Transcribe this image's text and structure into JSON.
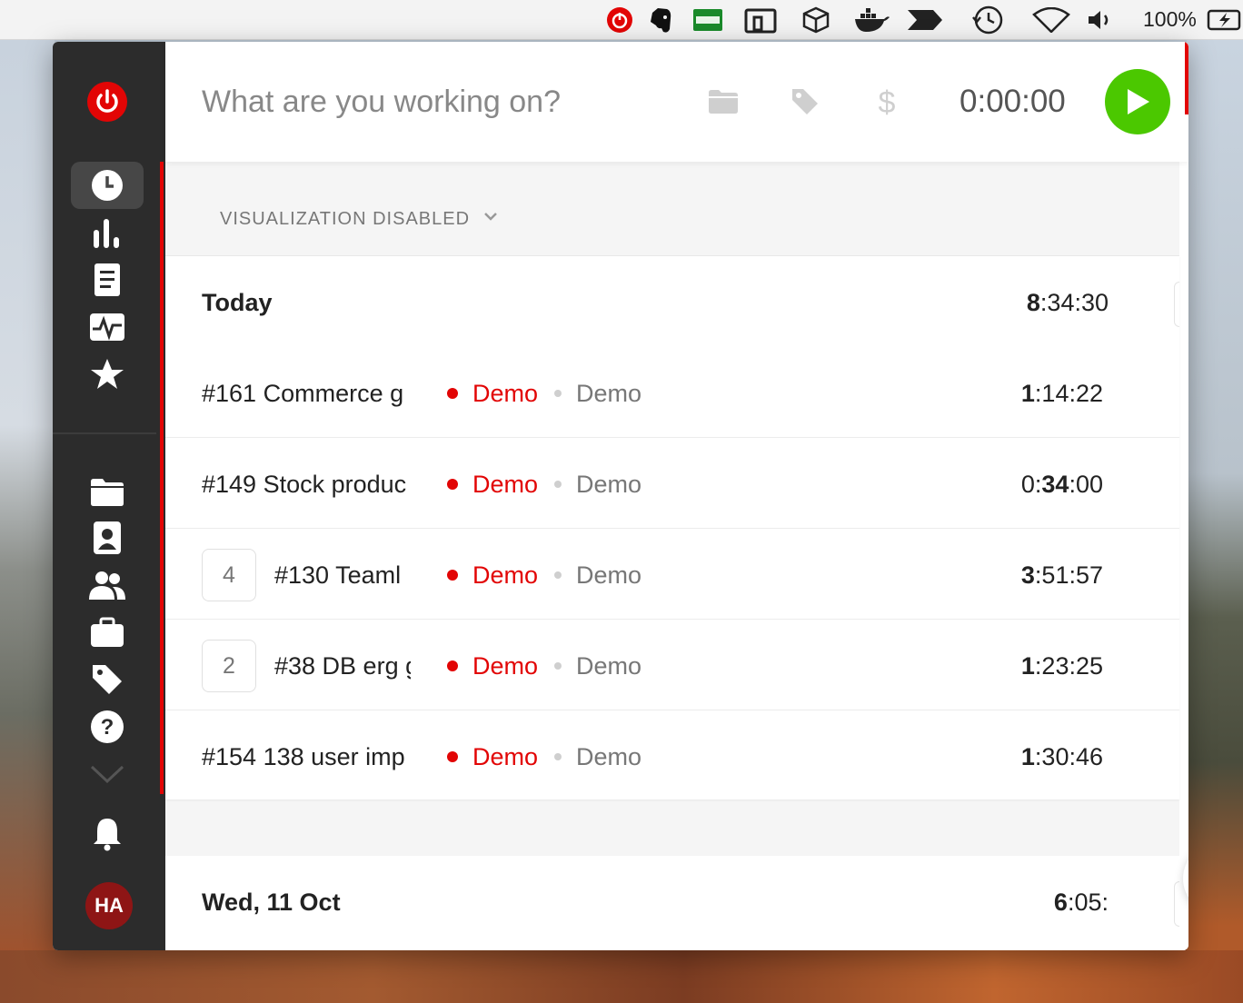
{
  "menubar": {
    "battery_percent": "100%",
    "icons": [
      "toggl-icon",
      "evernote-icon",
      "card-icon",
      "scroll-icon",
      "box-icon",
      "docker-icon",
      "arrows-icon",
      "time-machine-icon",
      "wifi-icon",
      "volume-icon",
      "battery-icon"
    ]
  },
  "timer": {
    "description_placeholder": "What are you working on?",
    "elapsed": "0:00:00",
    "accent_color": "#4bc800"
  },
  "visualization": {
    "label": "VISUALIZATION DISABLED"
  },
  "days": [
    {
      "title": "Today",
      "total_bold": "8",
      "total_rest": ":34:30",
      "entries": [
        {
          "count": "",
          "description": "#161 Commerce g",
          "project": "Demo",
          "client": "Demo",
          "dur_a": "",
          "dur_bold_a": "1",
          "dur_mid": ":14:22",
          "dur_bold_b": "",
          "dur_tail": ""
        },
        {
          "count": "",
          "description": "#149 Stock produc",
          "project": "Demo",
          "client": "Demo",
          "dur_a": "0:",
          "dur_bold_a": "",
          "dur_mid": "",
          "dur_bold_b": "34",
          "dur_tail": ":00"
        },
        {
          "count": "4",
          "description": "#130 Teaml",
          "project": "Demo",
          "client": "Demo",
          "dur_a": "",
          "dur_bold_a": "3",
          "dur_mid": ":51:57",
          "dur_bold_b": "",
          "dur_tail": ""
        },
        {
          "count": "2",
          "description": "#38 DB erg g",
          "project": "Demo",
          "client": "Demo",
          "dur_a": "",
          "dur_bold_a": "1",
          "dur_mid": ":23:25",
          "dur_bold_b": "",
          "dur_tail": ""
        },
        {
          "count": "",
          "description": "#154 138 user imp",
          "project": "Demo",
          "client": "Demo",
          "dur_a": "",
          "dur_bold_a": "1",
          "dur_mid": ":30:46",
          "dur_bold_b": "",
          "dur_tail": ""
        }
      ]
    },
    {
      "title": "Wed, 11 Oct",
      "total_bold": "6",
      "total_rest": ":05:",
      "entries": []
    }
  ],
  "user": {
    "initials": "HA"
  },
  "colors": {
    "brand_red": "#e20505",
    "sidebar_bg": "#2c2c2c",
    "play_green": "#4bc800"
  }
}
